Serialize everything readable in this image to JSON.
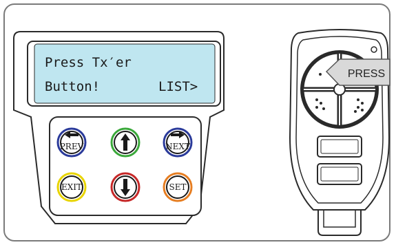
{
  "lcd": {
    "line1": "Press Tx′er",
    "line2_left": "Button!",
    "line2_right": "LIST>",
    "screen_color": "#bfe6f0"
  },
  "keypad": {
    "prev": {
      "label": "PREV",
      "ring_color": "#2a3a9a"
    },
    "up": {
      "ring_color": "#3aa83a"
    },
    "next": {
      "label": "NEXT",
      "ring_color": "#2a3a9a"
    },
    "exit": {
      "label": "EXIT",
      "ring_color": "#e8d400"
    },
    "down": {
      "ring_color": "#c62828"
    },
    "set": {
      "label": "SET",
      "ring_color": "#e67e22"
    }
  },
  "remote": {
    "press_label": "PRESS"
  }
}
